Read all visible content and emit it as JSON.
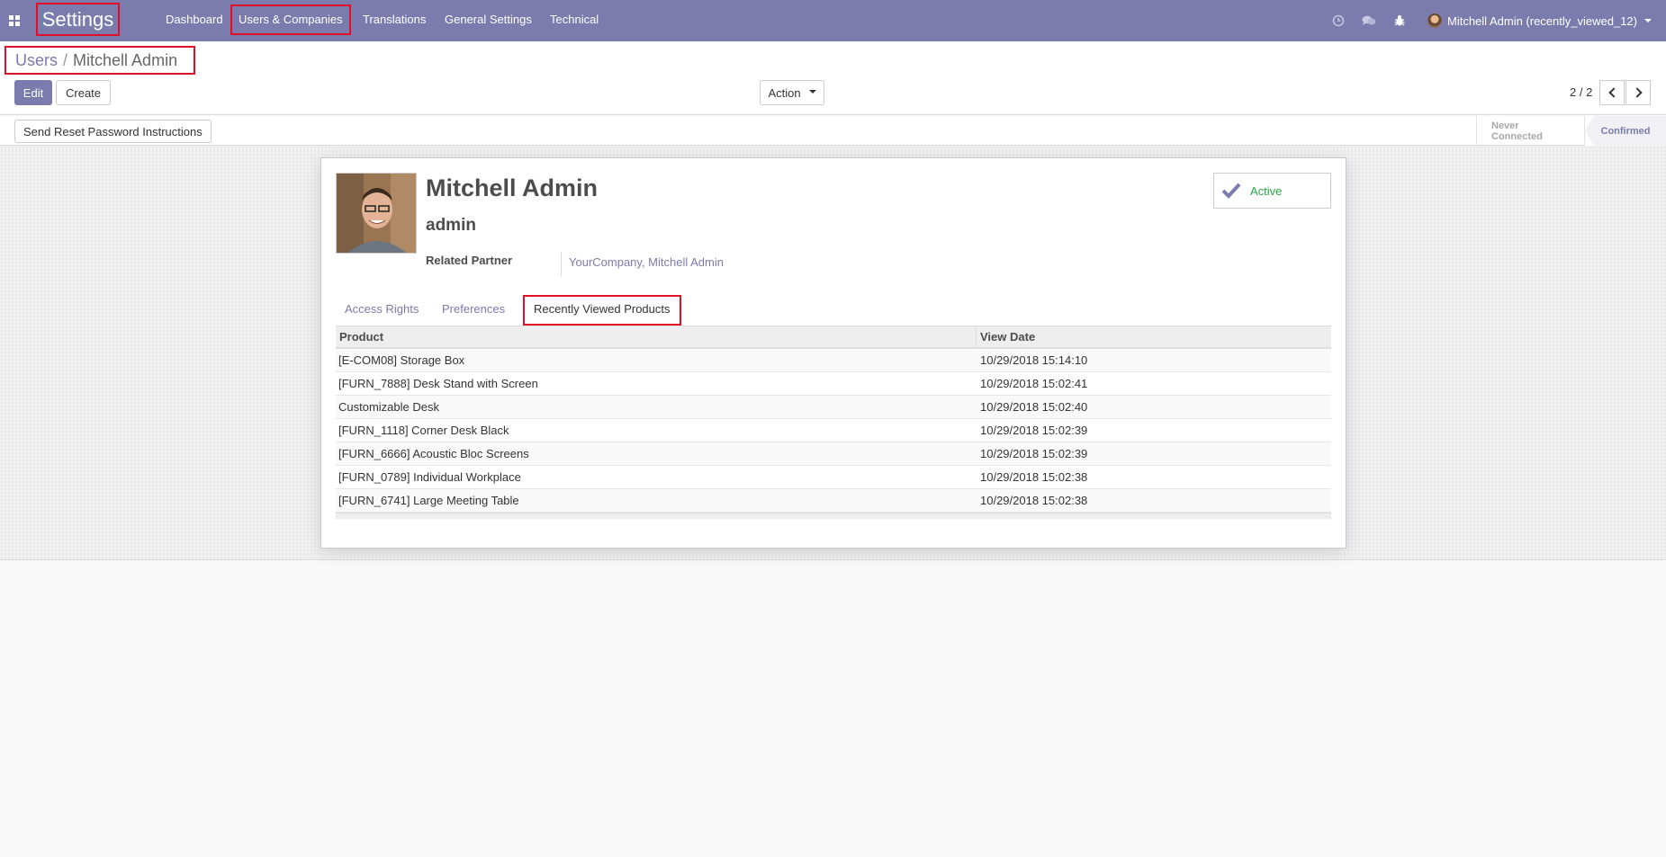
{
  "navbar": {
    "app_title": "Settings",
    "menu": [
      "Dashboard",
      "Users & Companies",
      "Translations",
      "General Settings",
      "Technical"
    ],
    "highlighted_menu": "Users & Companies",
    "user_label": "Mitchell Admin (recently_viewed_12)",
    "systray_icons": [
      "activity-clock-icon",
      "chat-bubbles-icon",
      "debug-bug-icon"
    ],
    "color": "#7c7bad"
  },
  "breadcrumb": {
    "parent": "Users",
    "separator": "/",
    "current": "Mitchell Admin"
  },
  "toolbar": {
    "edit_label": "Edit",
    "create_label": "Create",
    "action_label": "Action",
    "pager": "2 / 2"
  },
  "statusbar": {
    "reset_password_label": "Send Reset Password Instructions",
    "steps": [
      "Never Connected",
      "Confirmed"
    ],
    "current_step": "Confirmed"
  },
  "form": {
    "name": "Mitchell Admin",
    "login": "admin",
    "related_partner_label": "Related Partner",
    "related_partner_value": "YourCompany, Mitchell Admin",
    "active_label": "Active",
    "active_color": "#28a745"
  },
  "tabs": [
    "Access Rights",
    "Preferences",
    "Recently Viewed Products"
  ],
  "active_tab": "Recently Viewed Products",
  "table": {
    "headers": [
      "Product",
      "View Date"
    ],
    "rows": [
      [
        "[E-COM08] Storage Box",
        "10/29/2018 15:14:10"
      ],
      [
        "[FURN_7888] Desk Stand with Screen",
        "10/29/2018 15:02:41"
      ],
      [
        "Customizable Desk",
        "10/29/2018 15:02:40"
      ],
      [
        "[FURN_1118] Corner Desk Black",
        "10/29/2018 15:02:39"
      ],
      [
        "[FURN_6666] Acoustic Bloc Screens",
        "10/29/2018 15:02:39"
      ],
      [
        "[FURN_0789] Individual Workplace",
        "10/29/2018 15:02:38"
      ],
      [
        "[FURN_6741] Large Meeting Table",
        "10/29/2018 15:02:38"
      ]
    ]
  }
}
